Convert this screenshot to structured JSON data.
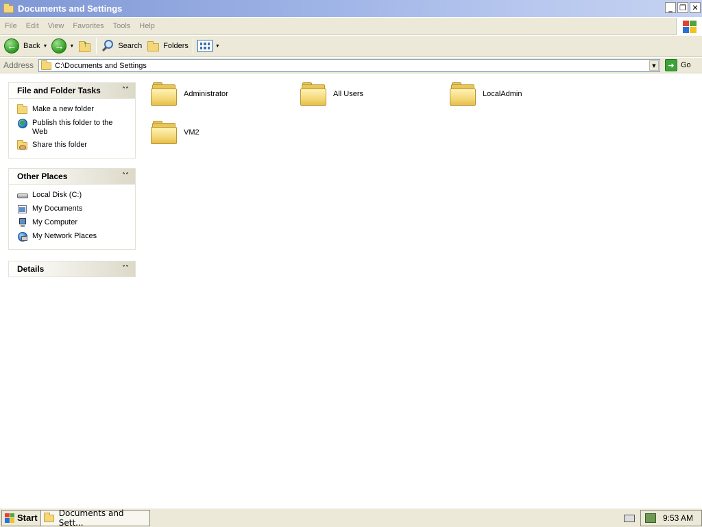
{
  "window": {
    "title": "Documents and Settings",
    "buttons": {
      "minimize": "_",
      "restore": "❐",
      "close": "✕"
    }
  },
  "menu": [
    "File",
    "Edit",
    "View",
    "Favorites",
    "Tools",
    "Help"
  ],
  "toolbar": {
    "back": "Back",
    "search": "Search",
    "folders": "Folders"
  },
  "address": {
    "label": "Address",
    "value": "C:\\Documents and Settings",
    "go": "Go"
  },
  "tasks_panel": {
    "title": "File and Folder Tasks",
    "items": [
      {
        "label": "Make a new folder",
        "icon": "new-folder-icon"
      },
      {
        "label": "Publish this folder to the Web",
        "icon": "publish-web-icon"
      },
      {
        "label": "Share this folder",
        "icon": "share-folder-icon"
      }
    ]
  },
  "places_panel": {
    "title": "Other Places",
    "items": [
      {
        "label": "Local Disk (C:)",
        "icon": "local-disk-icon"
      },
      {
        "label": "My Documents",
        "icon": "my-documents-icon"
      },
      {
        "label": "My Computer",
        "icon": "my-computer-icon"
      },
      {
        "label": "My Network Places",
        "icon": "network-places-icon"
      }
    ]
  },
  "details_panel": {
    "title": "Details"
  },
  "folders": [
    {
      "name": "Administrator"
    },
    {
      "name": "All Users"
    },
    {
      "name": "LocalAdmin"
    },
    {
      "name": "VM2"
    }
  ],
  "taskbar": {
    "start": "Start",
    "task": "Documents and Sett...",
    "clock": "9:53 AM"
  }
}
